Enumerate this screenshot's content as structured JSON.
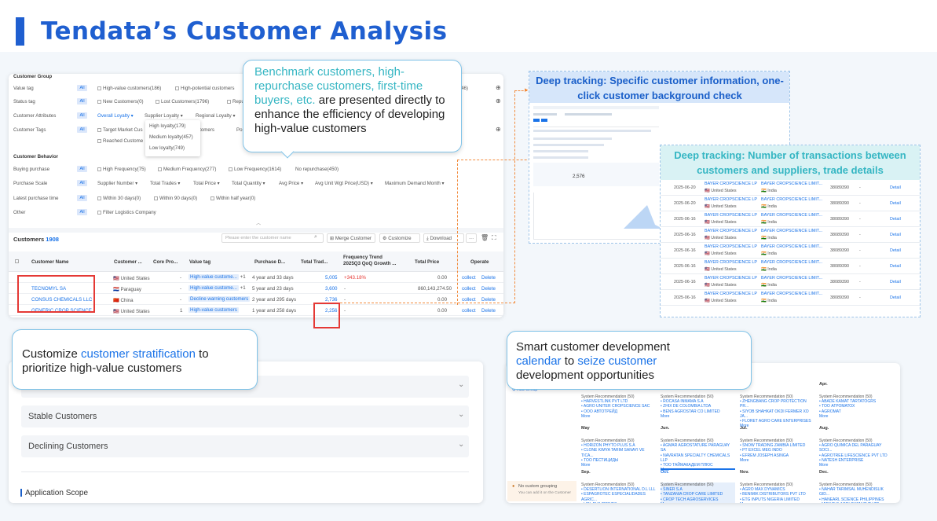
{
  "header": {
    "title": "Tendata’s Customer Analysis"
  },
  "filters": {
    "customer_group": "Customer Group",
    "value_tag": {
      "label": "Value tag",
      "all": "All",
      "options": [
        "High-value customers(186)",
        "High-potential customers"
      ]
    },
    "status_tag": {
      "label": "Status tag",
      "all": "All",
      "options": [
        "New Customers(0)",
        "Lost Customers(1796)",
        "Repu"
      ]
    },
    "customer_attributes": {
      "label": "Customer Attributes",
      "all": "All",
      "options": [
        "Overall Loyalty ▾",
        "Supplier Loyalty ▾",
        "Regional Loyalty ▾"
      ]
    },
    "customer_tags": {
      "label": "Customer Tags",
      "all": "All",
      "options": [
        "Target Market Cus",
        "Reached Custome",
        "stomers",
        "Po"
      ]
    },
    "loyalty_dropdown": [
      "High loyalty(179)",
      "Medium loyalty(457)",
      "Low loyalty(749)"
    ],
    "customer_behavior": "Customer Behavior",
    "buying_purchase": {
      "label": "Buying purchase",
      "all": "All",
      "options": [
        "High Frequency(75)",
        "Medium Frequency(277)",
        "Low Frequency(1614)",
        "No repurchase(450)"
      ]
    },
    "purchase_scale": {
      "label": "Purchase Scale",
      "all": "All",
      "options": [
        "Supplier Number ▾",
        "Total Trades ▾",
        "Total Price ▾",
        "Total Quantity ▾",
        "Avg Price ▾",
        "Avg Unit Wgt Price(USD) ▾",
        "Maximum Demand Month ▾"
      ]
    },
    "latest_purchase": {
      "label": "Latest purchase time",
      "all": "All",
      "options": [
        "Within 30 days(0)",
        "Within 90 days(0)",
        "Within half year(0)"
      ]
    },
    "other": {
      "label": "Other",
      "all": "All",
      "options": [
        "Filter Logistics Company"
      ]
    },
    "right_count": "46)"
  },
  "table": {
    "customers_label": "Customers",
    "customers_count": "1908",
    "search_placeholder": "Please enter the customer name",
    "merge": "Merge Customer",
    "customize": "Customize",
    "download": "Download",
    "more": "···",
    "headers": [
      "Customer Name",
      "Customer ...",
      "Core Pro...",
      "Value tag",
      "Purchase D...",
      "Total Trad...",
      "Frequency Trend 2025Q3 QoQ Growth ...",
      "Total Price",
      "Operate"
    ],
    "rows": [
      {
        "name": "",
        "country": "United States",
        "core": "-",
        "tag": "High-value custome...",
        "plus": "+1",
        "date": "4 year and 33 days",
        "trades": "5,005",
        "trend": "+343.18%",
        "price": "0.00",
        "op1": "collect",
        "op2": "Delete"
      },
      {
        "name": "TECNOMYL SA",
        "country": "Paraguay",
        "core": "-",
        "tag": "High-value custome...",
        "plus": "+1",
        "date": "5 year and 23 days",
        "trades": "3,600",
        "trend": "-",
        "price": "860,143,274.50",
        "op1": "collect",
        "op2": "Delete"
      },
      {
        "name": "CONSUS CHEMICALS LLC",
        "country": "China",
        "core": "-",
        "tag": "Decline warning customers",
        "plus": "",
        "date": "2 year and 295 days",
        "trades": "2,736",
        "trend": "-",
        "price": "0.00",
        "op1": "collect",
        "op2": "Delete"
      },
      {
        "name": "GENERIC CROP SCIENCE",
        "country": "United States",
        "core": "1",
        "tag": "High-value customers",
        "plus": "",
        "date": "1 year and 258 days",
        "trades": "2,256",
        "trend": "-",
        "price": "0.00",
        "op1": "collect",
        "op2": "Delete"
      }
    ]
  },
  "callouts": {
    "c1": {
      "t1": "Benchmark customers, high-repurchase customers, first-time buyers, etc.",
      "t2": " are presented directly to enhance the efficiency of developing high-value customers"
    },
    "c2": {
      "t1": "Customize ",
      "t2": "customer stratification",
      "t3": " to prioritize high-value customers"
    },
    "c3": {
      "t1": "Smart customer development ",
      "t2": "calendar",
      "t3": " to ",
      "t4": "seize customer",
      "t5": " development opportunities"
    }
  },
  "deep1": {
    "title": "Deep tracking: Specific customer information, one-click customer background check",
    "val": "2,576"
  },
  "deep2": {
    "title": "Deep tracking: Number of transactions between customers and suppliers, trade details",
    "rows": [
      {
        "date": "2025-06-20",
        "buyer": "BAYER CROPSCIENCE LP",
        "bc": "United States",
        "seller": "BAYER CROPSCIENCE LIMIT...",
        "sc": "India",
        "hs": "38089390",
        "x": "-",
        "link": "Detail"
      },
      {
        "date": "2025-06-20",
        "buyer": "BAYER CROPSCIENCE LP",
        "bc": "United States",
        "seller": "BAYER CROPSCIENCE LIMIT...",
        "sc": "India",
        "hs": "38089390",
        "x": "-",
        "link": "Detail"
      },
      {
        "date": "2025-06-16",
        "buyer": "BAYER CROPSCIENCE LP",
        "bc": "United States",
        "seller": "BAYER CROPSCIENCE LIMIT...",
        "sc": "India",
        "hs": "38089390",
        "x": "-",
        "link": "Detail"
      },
      {
        "date": "2025-06-16",
        "buyer": "BAYER CROPSCIENCE LP",
        "bc": "United States",
        "seller": "BAYER CROPSCIENCE LIMIT...",
        "sc": "India",
        "hs": "38089390",
        "x": "-",
        "link": "Detail"
      },
      {
        "date": "2025-06-16",
        "buyer": "BAYER CROPSCIENCE LP",
        "bc": "United States",
        "seller": "BAYER CROPSCIENCE LIMIT...",
        "sc": "India",
        "hs": "38089390",
        "x": "-",
        "link": "Detail"
      },
      {
        "date": "2025-06-16",
        "buyer": "BAYER CROPSCIENCE LP",
        "bc": "United States",
        "seller": "BAYER CROPSCIENCE LIMIT...",
        "sc": "India",
        "hs": "38089390",
        "x": "-",
        "link": "Detail"
      },
      {
        "date": "2025-06-16",
        "buyer": "BAYER CROPSCIENCE LP",
        "bc": "United States",
        "seller": "BAYER CROPSCIENCE LIMIT...",
        "sc": "India",
        "hs": "38089390",
        "x": "-",
        "link": "Detail"
      },
      {
        "date": "2025-06-16",
        "buyer": "BAYER CROPSCIENCE LP",
        "bc": "United States",
        "seller": "BAYER CROPSCIENCE LIMIT...",
        "sc": "India",
        "hs": "38089390",
        "x": "-",
        "link": "Detail"
      }
    ]
  },
  "strat": {
    "items": [
      "Stable Customers",
      "Declining Customers"
    ],
    "scope": "Application Scope"
  },
  "calendar": {
    "add": "Add Group",
    "no_group": "No custom grouping",
    "no_group_sub": "You can add it on the Customer",
    "no_group_link": "Customer",
    "months": [
      "Apr.",
      "May",
      "Jun.",
      "Jul.",
      "Aug.",
      "Sep.",
      "Oct.",
      "Nov.",
      "Dec."
    ],
    "rec": "System Recommendation  (50)",
    "cells": [
      [
        "HARVESTLINK PVT LTD",
        "AGRO UNITER CROPSCIENCE SAC",
        "ООО АВТОТРЕЙД"
      ],
      [
        "ROCASA INMAMA S.A",
        "ZHIX DE COLOMBIA LTDA",
        "BENS AGROSTAR CO LIMITED"
      ],
      [
        "ZHENGBANG CROP PROTECTION PR...",
        "SIYOB SHAHKAT OKDI FERMER XO JA...",
        "FLORET AGRO CARE ENTERPRISES"
      ],
      [
        "ABADE KAMAT TARTATOGRS",
        "TOO АГРОМАТОХ",
        "AGROMAT"
      ],
      [
        "HORIZON PHYTO PLUS S.A",
        "CLONE KIMYA TARIM SANAYI VE TICA...",
        "ТОО ПЕСТИЦИДЫ"
      ],
      [
        "AGMAR AGROSTATURE PARAGUAY SA",
        "NAVRATAN SPECIALTY CHEMICALS LLP",
        "ТОО ТАЙМАКАДЕМ ПЛЮС"
      ],
      [
        "SNOW TRADING ZAMBIA LIMITED",
        "PT EXCEL MEG INDO",
        "EFREM JOSEPH ASINGA"
      ],
      [
        "AGRO QUIMICA DEL PARAGUAY SOCI...",
        "AGROTREE LIFESCIENCE PVT LTD",
        "NATESH ENTERPRISE"
      ],
      [
        "DESERTLION INTERNATIONAL D.L LLL",
        "ESPAGROTEC ESPECIALIDADES AGRIC...",
        "LIPL PHILIPPINES"
      ],
      [
        "SINER S.A",
        "TANZANIA CROP CARE LIMITED",
        "CROP TECH AGROSERVICES"
      ],
      [
        "AGRO MAX DYNAMICS",
        "BENIMIK DISTRIBUTORS PVT LTD",
        "ETG INPUTS NIGERIA LIMITED"
      ],
      [
        "NAHAR TARIMSAL MUHENDISLIK GID...",
        "HANEARL SCIENCE PHILIPPINES",
        "MIRACLE AGRI CHEM PVT LTD"
      ]
    ],
    "more": "More"
  }
}
